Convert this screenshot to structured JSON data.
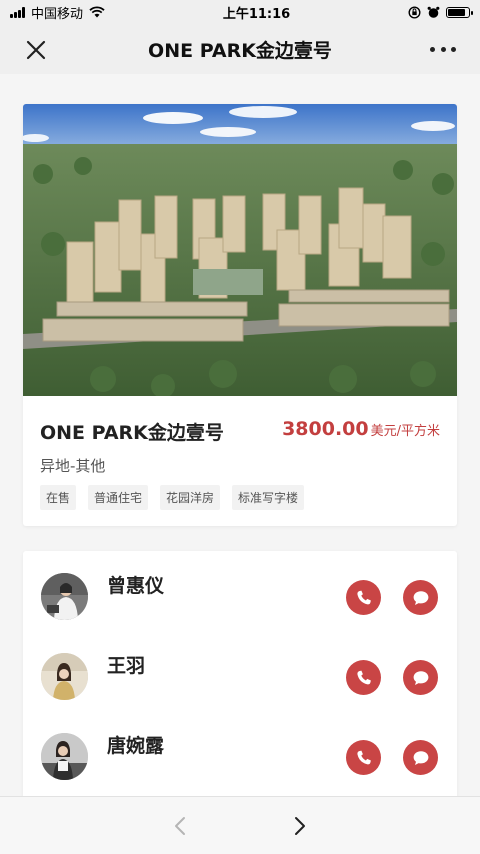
{
  "status_bar": {
    "carrier": "中国移动",
    "time": "上午11:16"
  },
  "nav": {
    "title": "ONE PARK金边壹号"
  },
  "property": {
    "name": "ONE PARK金边壹号",
    "price_value": "3800.00",
    "price_unit": "美元/平方米",
    "location": "异地-其他",
    "tags": [
      "在售",
      "普通住宅",
      "花园洋房",
      "标准写字楼"
    ],
    "image": "aerial-view-of-residential-development"
  },
  "agents": [
    {
      "name": "曾惠仪"
    },
    {
      "name": "王羽"
    },
    {
      "name": "唐婉露"
    }
  ],
  "icons": {
    "close": "close-icon",
    "more": "more-icon",
    "phone": "phone-icon",
    "chat": "chat-icon",
    "back": "chevron-left-icon",
    "forward": "chevron-right-icon"
  },
  "colors": {
    "accent": "#c94545",
    "price": "#c33f3f"
  },
  "status": {
    "battery_level": 0.85
  }
}
